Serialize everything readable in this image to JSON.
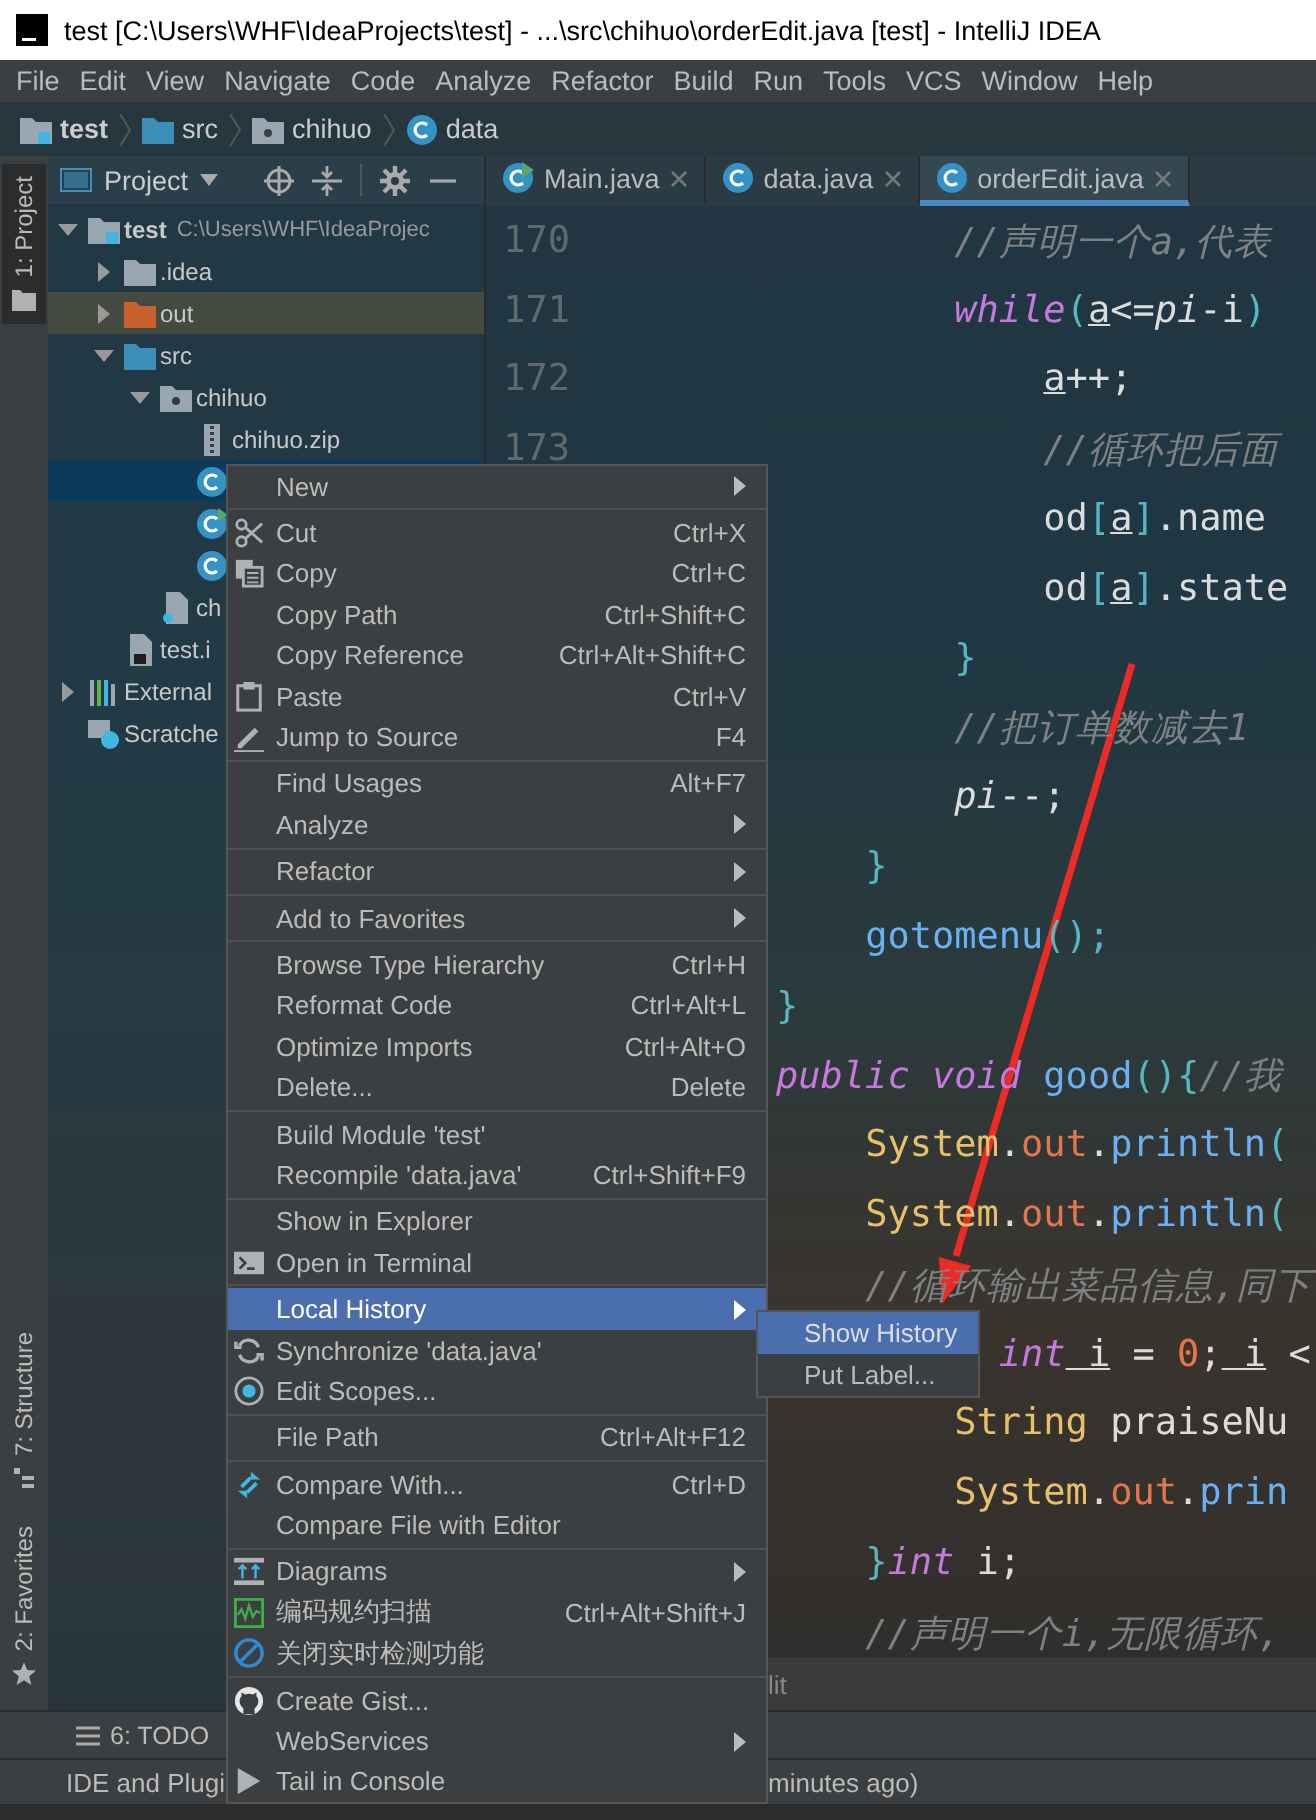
{
  "window": {
    "title": "test [C:\\Users\\WHF\\IdeaProjects\\test] - ...\\src\\chihuo\\orderEdit.java [test] - IntelliJ IDEA"
  },
  "menu_bar": [
    "File",
    "Edit",
    "View",
    "Navigate",
    "Code",
    "Analyze",
    "Refactor",
    "Build",
    "Run",
    "Tools",
    "VCS",
    "Window",
    "Help"
  ],
  "breadcrumbs": [
    {
      "label": "test",
      "kind": "module"
    },
    {
      "label": "src",
      "kind": "folder"
    },
    {
      "label": "chihuo",
      "kind": "package"
    },
    {
      "label": "data",
      "kind": "class"
    }
  ],
  "left_tool_windows": [
    {
      "label": "1: Project",
      "kind": "project",
      "selected": true
    },
    {
      "label": "7: Structure",
      "kind": "structure",
      "selected": false
    },
    {
      "label": "2: Favorites",
      "kind": "favorites",
      "selected": false
    }
  ],
  "project_panel": {
    "title": "Project",
    "tree": [
      {
        "label": "test",
        "path": "C:\\Users\\WHF\\IdeaProjec",
        "kind": "module",
        "expanded": true,
        "selected": false,
        "children": [
          {
            "label": ".idea",
            "kind": "folder",
            "expanded": false,
            "selected": false
          },
          {
            "label": "out",
            "kind": "excluded-folder",
            "expanded": false,
            "selected": false
          },
          {
            "label": "src",
            "kind": "source-folder",
            "expanded": true,
            "selected": false,
            "children": [
              {
                "label": "chihuo",
                "kind": "package",
                "expanded": true,
                "selected": false,
                "children": [
                  {
                    "label": "chihuo.zip",
                    "kind": "archive",
                    "selected": false
                  },
                  {
                    "kind": "class",
                    "selected": true
                  },
                  {
                    "kind": "main-class",
                    "selected": false
                  },
                  {
                    "kind": "class",
                    "selected": false
                  }
                ]
              },
              {
                "label": "ch",
                "kind": "unknown-file",
                "selected": false
              }
            ]
          },
          {
            "label": "test.i",
            "kind": "module-file",
            "selected": false
          }
        ]
      },
      {
        "label": "External",
        "kind": "libraries",
        "expanded": false,
        "selected": false
      },
      {
        "label": "Scratche",
        "kind": "scratches",
        "selected": false
      }
    ]
  },
  "editor_tabs": [
    {
      "label": "Main.java",
      "kind": "main-class",
      "selected": false
    },
    {
      "label": "data.java",
      "kind": "class",
      "selected": false
    },
    {
      "label": "orderEdit.java",
      "kind": "class",
      "selected": true
    }
  ],
  "editor": {
    "lines": [
      {
        "number": "170",
        "tokens": [
          {
            "kind": "comment",
            "text": "        //声明一个a,代表"
          }
        ]
      },
      {
        "number": "171",
        "tokens": [
          {
            "kind": "keyword",
            "text": "        while"
          },
          {
            "kind": "bracket",
            "text": "("
          },
          {
            "kind": "variable",
            "text": "a"
          },
          {
            "kind": "plain",
            "text": "<="
          },
          {
            "kind": "static",
            "text": "pi"
          },
          {
            "kind": "plain",
            "text": "-i"
          },
          {
            "kind": "bracket",
            "text": ")"
          }
        ]
      },
      {
        "number": "172",
        "tokens": [
          {
            "kind": "variable",
            "text": "            a"
          },
          {
            "kind": "plain",
            "text": "++;"
          }
        ]
      },
      {
        "number": "173",
        "tokens": [
          {
            "kind": "comment",
            "text": "            //循环把后面"
          }
        ]
      },
      {
        "tokens": [
          {
            "kind": "plain",
            "text": "            od"
          },
          {
            "kind": "bracket",
            "text": "["
          },
          {
            "kind": "variable",
            "text": "a"
          },
          {
            "kind": "bracket",
            "text": "]"
          },
          {
            "kind": "plain",
            "text": ".name"
          }
        ]
      },
      {
        "tokens": [
          {
            "kind": "plain",
            "text": "            od"
          },
          {
            "kind": "bracket",
            "text": "["
          },
          {
            "kind": "variable",
            "text": "a"
          },
          {
            "kind": "bracket",
            "text": "]"
          },
          {
            "kind": "plain",
            "text": ".state"
          }
        ]
      },
      {
        "tokens": [
          {
            "kind": "bracket",
            "text": "        }"
          }
        ]
      },
      {
        "tokens": [
          {
            "kind": "comment",
            "text": "        //把订单数减去1"
          }
        ]
      },
      {
        "tokens": [
          {
            "kind": "static",
            "text": "        pi"
          },
          {
            "kind": "plain",
            "text": "--;"
          }
        ]
      },
      {
        "tokens": [
          {
            "kind": "bracket",
            "text": "    }"
          }
        ]
      },
      {
        "tokens": [
          {
            "kind": "method",
            "text": "    gotomenu"
          },
          {
            "kind": "bracket",
            "text": "();"
          }
        ]
      },
      {
        "tokens": [
          {
            "kind": "bracket",
            "text": "}"
          }
        ]
      },
      {
        "tokens": [
          {
            "kind": "keyword",
            "text": "public"
          },
          {
            "kind": "keyword",
            "text": " void"
          },
          {
            "kind": "method",
            "text": " good"
          },
          {
            "kind": "bracket",
            "text": "(){"
          },
          {
            "kind": "comment",
            "text": "//我"
          }
        ]
      },
      {
        "tokens": [
          {
            "kind": "class",
            "text": "    System"
          },
          {
            "kind": "plain",
            "text": "."
          },
          {
            "kind": "field",
            "text": "out"
          },
          {
            "kind": "plain",
            "text": "."
          },
          {
            "kind": "method",
            "text": "println"
          },
          {
            "kind": "bracket",
            "text": "("
          }
        ]
      },
      {
        "tokens": [
          {
            "kind": "class",
            "text": "    System"
          },
          {
            "kind": "plain",
            "text": "."
          },
          {
            "kind": "field",
            "text": "out"
          },
          {
            "kind": "plain",
            "text": "."
          },
          {
            "kind": "method",
            "text": "println"
          },
          {
            "kind": "bracket",
            "text": "("
          }
        ]
      },
      {
        "tokens": [
          {
            "kind": "comment",
            "text": "    //循环输出菜品信息,同下"
          }
        ]
      },
      {
        "tokens": [
          {
            "kind": "keyword",
            "text": "          int"
          },
          {
            "kind": "variable",
            "text": " i"
          },
          {
            "kind": "plain",
            "text": " = "
          },
          {
            "kind": "number",
            "text": "0"
          },
          {
            "kind": "plain",
            "text": ";"
          },
          {
            "kind": "variable",
            "text": " i"
          },
          {
            "kind": "plain",
            "text": " <"
          }
        ]
      },
      {
        "tokens": [
          {
            "kind": "class",
            "text": "        String"
          },
          {
            "kind": "plain",
            "text": " praiseNu"
          }
        ]
      },
      {
        "tokens": [
          {
            "kind": "class",
            "text": "        System"
          },
          {
            "kind": "plain",
            "text": "."
          },
          {
            "kind": "field",
            "text": "out"
          },
          {
            "kind": "plain",
            "text": "."
          },
          {
            "kind": "method",
            "text": "prin"
          }
        ]
      },
      {
        "tokens": [
          {
            "kind": "bracket",
            "text": "    }"
          },
          {
            "kind": "keyword",
            "text": "int"
          },
          {
            "kind": "plain",
            "text": " i;"
          }
        ]
      },
      {
        "tokens": [
          {
            "kind": "comment",
            "text": "    //声明一个i,无限循环,"
          }
        ]
      }
    ]
  },
  "editor_footer": "lit",
  "bottom_tool_windows": [
    {
      "label": "6: TODO"
    }
  ],
  "status_bar": {
    "left": "IDE and Plugi",
    "right": "minutes ago)"
  },
  "context_menu": {
    "items": [
      {
        "kind": "item",
        "label": "New",
        "submenu": true,
        "selected": false
      },
      {
        "kind": "separator"
      },
      {
        "kind": "cut",
        "label": "Cut",
        "shortcut": "Ctrl+X",
        "submenu": false,
        "selected": false
      },
      {
        "kind": "copy",
        "label": "Copy",
        "shortcut": "Ctrl+C",
        "submenu": false,
        "selected": false
      },
      {
        "kind": "item",
        "label": "Copy Path",
        "shortcut": "Ctrl+Shift+C",
        "submenu": false,
        "selected": false
      },
      {
        "kind": "item",
        "label": "Copy Reference",
        "shortcut": "Ctrl+Alt+Shift+C",
        "submenu": false,
        "selected": false
      },
      {
        "kind": "paste",
        "label": "Paste",
        "shortcut": "Ctrl+V",
        "submenu": false,
        "selected": false
      },
      {
        "kind": "edit",
        "label": "Jump to Source",
        "shortcut": "F4",
        "submenu": false,
        "selected": false
      },
      {
        "kind": "separator"
      },
      {
        "kind": "item",
        "label": "Find Usages",
        "shortcut": "Alt+F7",
        "submenu": false,
        "selected": false
      },
      {
        "kind": "item",
        "label": "Analyze",
        "submenu": true,
        "selected": false
      },
      {
        "kind": "separator"
      },
      {
        "kind": "item",
        "label": "Refactor",
        "submenu": true,
        "selected": false
      },
      {
        "kind": "separator"
      },
      {
        "kind": "item",
        "label": "Add to Favorites",
        "submenu": true,
        "selected": false
      },
      {
        "kind": "separator"
      },
      {
        "kind": "item",
        "label": "Browse Type Hierarchy",
        "shortcut": "Ctrl+H",
        "submenu": false,
        "selected": false
      },
      {
        "kind": "item",
        "label": "Reformat Code",
        "shortcut": "Ctrl+Alt+L",
        "submenu": false,
        "selected": false
      },
      {
        "kind": "item",
        "label": "Optimize Imports",
        "shortcut": "Ctrl+Alt+O",
        "submenu": false,
        "selected": false
      },
      {
        "kind": "item",
        "label": "Delete...",
        "shortcut": "Delete",
        "submenu": false,
        "selected": false
      },
      {
        "kind": "separator"
      },
      {
        "kind": "item",
        "label": "Build Module 'test'",
        "submenu": false,
        "selected": false
      },
      {
        "kind": "item",
        "label": "Recompile 'data.java'",
        "shortcut": "Ctrl+Shift+F9",
        "submenu": false,
        "selected": false
      },
      {
        "kind": "separator"
      },
      {
        "kind": "item",
        "label": "Show in Explorer",
        "submenu": false,
        "selected": false
      },
      {
        "kind": "terminal",
        "label": "Open in Terminal",
        "submenu": false,
        "selected": false
      },
      {
        "kind": "separator"
      },
      {
        "kind": "item",
        "label": "Local History",
        "submenu": true,
        "selected": true
      },
      {
        "kind": "sync",
        "label": "Synchronize 'data.java'",
        "submenu": false,
        "selected": false
      },
      {
        "kind": "scope",
        "label": "Edit Scopes...",
        "submenu": false,
        "selected": false
      },
      {
        "kind": "separator"
      },
      {
        "kind": "item",
        "label": "File Path",
        "shortcut": "Ctrl+Alt+F12",
        "submenu": false,
        "selected": false
      },
      {
        "kind": "separator"
      },
      {
        "kind": "compare",
        "label": "Compare With...",
        "shortcut": "Ctrl+D",
        "submenu": false,
        "selected": false
      },
      {
        "kind": "item",
        "label": "Compare File with Editor",
        "submenu": false,
        "selected": false
      },
      {
        "kind": "separator"
      },
      {
        "kind": "diagram",
        "label": "Diagrams",
        "submenu": true,
        "selected": false
      },
      {
        "kind": "scan",
        "label": "编码规约扫描",
        "shortcut": "Ctrl+Alt+Shift+J",
        "submenu": false,
        "selected": false
      },
      {
        "kind": "disable",
        "label": "关闭实时检测功能",
        "submenu": false,
        "selected": false
      },
      {
        "kind": "separator"
      },
      {
        "kind": "gist",
        "label": "Create Gist...",
        "submenu": false,
        "selected": false
      },
      {
        "kind": "item",
        "label": "WebServices",
        "submenu": true,
        "selected": false
      },
      {
        "kind": "tail",
        "label": "Tail in Console",
        "submenu": false,
        "selected": false
      }
    ]
  },
  "submenu": {
    "items": [
      {
        "label": "Show History",
        "selected": true
      },
      {
        "label": "Put Label...",
        "selected": false
      }
    ]
  }
}
